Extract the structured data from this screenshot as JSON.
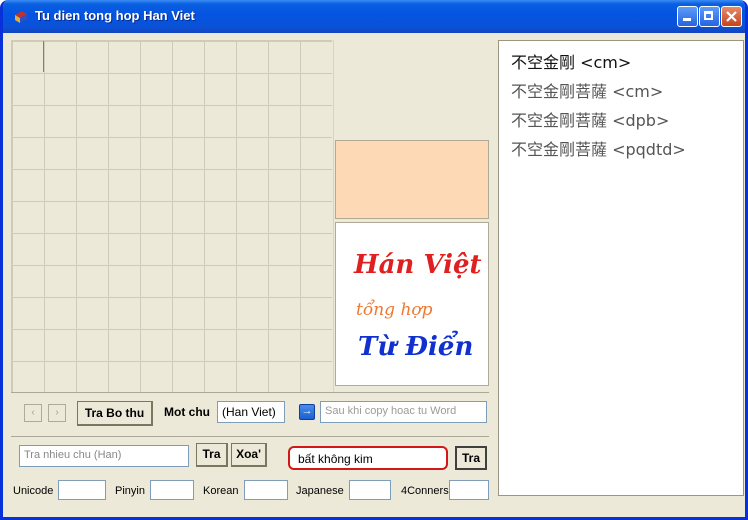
{
  "window": {
    "title": "Tu dien tong hop Han Viet",
    "title_icon": "book-icon"
  },
  "results": [
    {
      "text": "不空金剛 <cm>"
    },
    {
      "text": "不空金剛菩薩 <cm>"
    },
    {
      "text": "不空金剛菩薩 <dpb>"
    },
    {
      "text": "不空金剛菩薩 <pqdtd>"
    }
  ],
  "logo": {
    "line1": "Hán Việt",
    "line2": "tổng hợp",
    "line3": "Từ Điển",
    "colors": {
      "line1": "#e02020",
      "line2": "#f07830",
      "line3": "#1030d0"
    }
  },
  "toolbar": {
    "prev": "‹",
    "next": "›",
    "tra_bo_thu": "Tra Bo thu",
    "mot_chu_label": "Mot chu",
    "mot_chu_value": "(Han Viet)",
    "arrow": "→",
    "copy_placeholder": "Sau khi copy hoac tu Word"
  },
  "search": {
    "tra_nhieu_placeholder": "Tra nhieu chu (Han)",
    "tra_label": "Tra",
    "xoa_label": "Xoa'",
    "query": "bất không kim",
    "tra2_label": "Tra"
  },
  "codes": [
    {
      "label": "Unicode"
    },
    {
      "label": "Pinyin"
    },
    {
      "label": "Korean"
    },
    {
      "label": "Japanese"
    },
    {
      "label": "4Conners"
    }
  ]
}
